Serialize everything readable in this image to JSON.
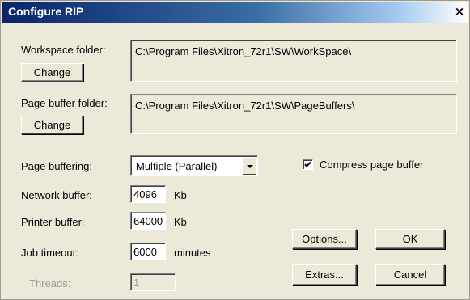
{
  "window": {
    "title": "Configure RIP",
    "close_glyph": "×"
  },
  "workspace": {
    "label": "Workspace folder:",
    "change_label": "Change",
    "path": "C:\\Program Files\\Xitron_72r1\\SW\\WorkSpace\\"
  },
  "pagebuffer": {
    "label": "Page buffer folder:",
    "change_label": "Change",
    "path": "C:\\Program Files\\Xitron_72r1\\SW\\PageBuffers\\"
  },
  "page_buffering": {
    "label": "Page buffering:",
    "selected": "Multiple (Parallel)"
  },
  "compress": {
    "label": "Compress page buffer",
    "checked": true
  },
  "network_buffer": {
    "label": "Network buffer:",
    "value": "4096",
    "unit": "Kb"
  },
  "printer_buffer": {
    "label": "Printer buffer:",
    "value": "64000",
    "unit": "Kb"
  },
  "job_timeout": {
    "label": "Job timeout:",
    "value": "6000",
    "unit": "minutes"
  },
  "threads": {
    "label": "Threads:",
    "value": "1"
  },
  "buttons": {
    "options": "Options...",
    "ok": "OK",
    "extras": "Extras...",
    "cancel": "Cancel"
  }
}
